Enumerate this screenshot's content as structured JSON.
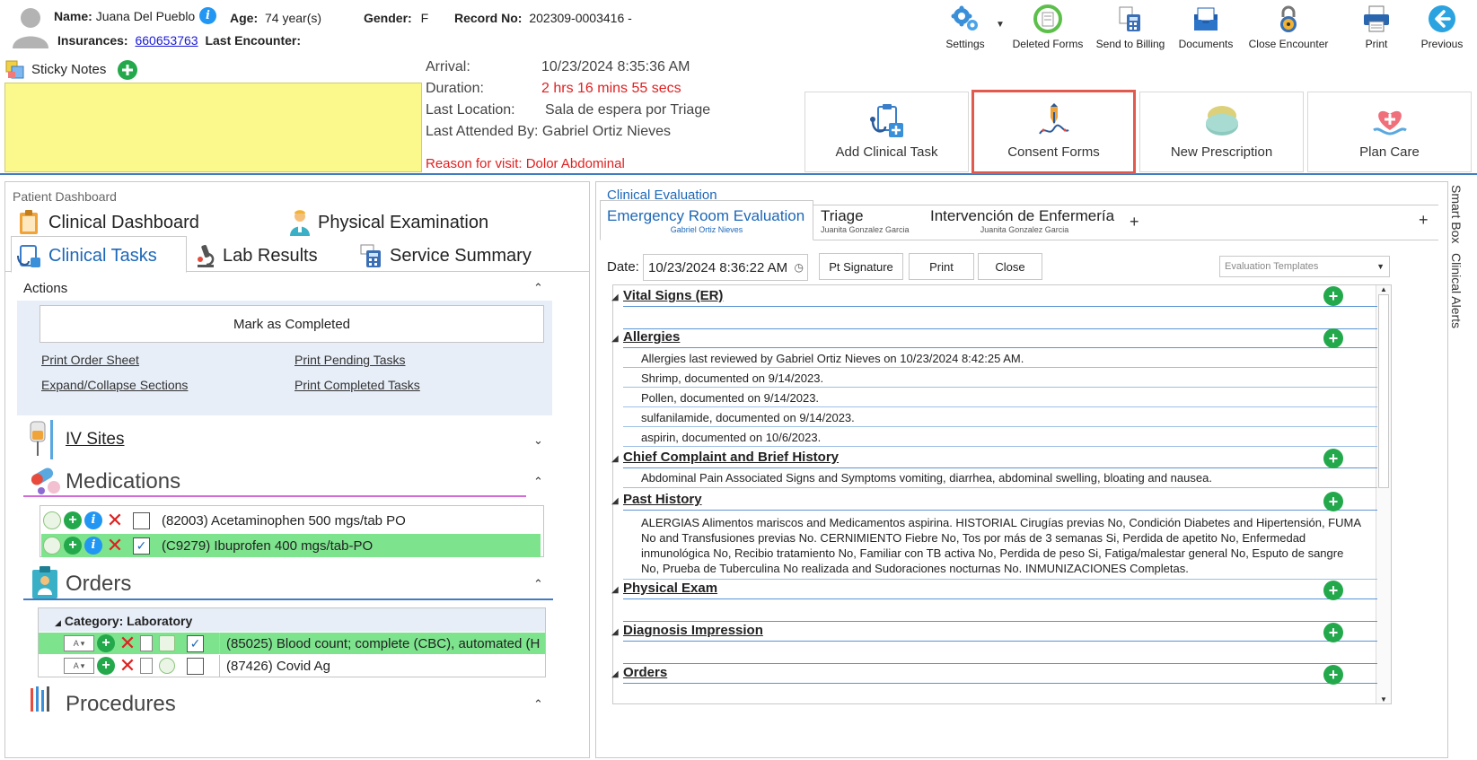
{
  "patient": {
    "name_label": "Name:",
    "name": "Juana Del Pueblo",
    "age_label": "Age:",
    "age": "74 year(s)",
    "gender_label": "Gender:",
    "gender": "F",
    "record_label": "Record No:",
    "record": "202309-0003416 -",
    "insurances_label": "Insurances:",
    "insurances": "660653763",
    "last_encounter_label": "Last Encounter:"
  },
  "toolbar": [
    {
      "label": "Settings",
      "icon": "gear-icon"
    },
    {
      "label": "Deleted Forms",
      "icon": "deleted-forms-icon"
    },
    {
      "label": "Send to Billing",
      "icon": "billing-icon"
    },
    {
      "label": "Documents",
      "icon": "documents-icon"
    },
    {
      "label": "Close Encounter",
      "icon": "lock-icon"
    },
    {
      "label": "Print",
      "icon": "printer-icon"
    },
    {
      "label": "Previous",
      "icon": "arrow-left-icon"
    }
  ],
  "sticky": {
    "label": "Sticky Notes"
  },
  "visit": {
    "arrival_label": "Arrival:",
    "arrival": "10/23/2024 8:35:36 AM",
    "duration_label": "Duration:",
    "duration": "2 hrs 16 mins 55 secs",
    "location_label": "Last Location:",
    "location": "Sala de espera por Triage",
    "attended_label": "Last Attended By:",
    "attended": "Gabriel Ortiz Nieves",
    "reason": "Reason for visit: Dolor Abdominal"
  },
  "actions_bar": [
    {
      "label": "Add Clinical Task"
    },
    {
      "label": "Consent Forms"
    },
    {
      "label": "New Prescription"
    },
    {
      "label": "Plan Care"
    }
  ],
  "left": {
    "title": "Patient Dashboard",
    "tabs": {
      "dashboard": "Clinical Dashboard",
      "physical": "Physical Examination",
      "tasks": "Clinical Tasks",
      "lab": "Lab Results",
      "service": "Service Summary"
    },
    "actions_title": "Actions",
    "mark_completed": "Mark as Completed",
    "print_order": "Print Order Sheet",
    "print_pending": "Print Pending Tasks",
    "expand_collapse": "Expand/Collapse Sections",
    "print_completed": "Print Completed Tasks",
    "iv_sites": "IV Sites",
    "medications_title": "Medications",
    "medications": [
      {
        "text": "(82003) Acetaminophen 500 mgs/tab PO",
        "checked": false
      },
      {
        "text": "(C9279) Ibuprofen 400 mgs/tab-PO",
        "checked": true
      }
    ],
    "orders_title": "Orders",
    "orders_category": "Category: Laboratory",
    "orders": [
      {
        "text": "(85025) Blood count; complete (CBC), automated (H",
        "checked": true
      },
      {
        "text": "(87426) Covid Ag",
        "checked": false
      }
    ],
    "procedures_title": "Procedures"
  },
  "right": {
    "title": "Clinical Evaluation",
    "tabs": [
      {
        "main": "Emergency Room Evaluation",
        "sub": "Gabriel Ortiz Nieves"
      },
      {
        "main": "Triage",
        "sub": "Juanita Gonzalez Garcia"
      },
      {
        "main": "Intervención de Enfermería",
        "sub": "Juanita Gonzalez Garcia"
      }
    ],
    "date_label": "Date:",
    "date_value": "10/23/2024 8:36:22 AM",
    "pt_signature": "Pt Signature",
    "print": "Print",
    "close": "Close",
    "templates_placeholder": "Evaluation Templates",
    "sections": {
      "vital_signs": "Vital Signs (ER)",
      "allergies": "Allergies",
      "allergy_items": [
        "Allergies last reviewed by Gabriel Ortiz Nieves on 10/23/2024 8:42:25 AM.",
        "Shrimp, documented on 9/14/2023.",
        "Pollen, documented on 9/14/2023.",
        "sulfanilamide, documented on 9/14/2023.",
        "aspirin, documented on 10/6/2023."
      ],
      "chief": "Chief Complaint and Brief History",
      "chief_text": "Abdominal Pain Associated Signs and Symptoms vomiting, diarrhea, abdominal swelling, bloating and nausea.",
      "past": "Past History",
      "past_lines": [
        "ALERGIAS Alimentos mariscos and Medicamentos aspirina. HISTORIAL Cirugías previas No, Condición Diabetes and Hipertensión, FUMA",
        "No and Transfusiones previas No. CERNIMIENTO Fiebre No, Tos por más de 3 semanas Si, Perdida de apetito No, Enfermedad",
        "inmunológica No, Recibio tratamiento No, Familiar con TB activa No, Perdida de peso Si, Fatiga/malestar general No, Esputo de sangre",
        "No, Prueba de Tuberculina No realizada and Sudoraciones nocturnas No. INMUNIZACIONES Completas."
      ],
      "physical": "Physical Exam",
      "diagnosis": "Diagnosis Impression",
      "orders": "Orders"
    }
  },
  "side": {
    "smart_box": "Smart Box",
    "clinical_alerts": "Clinical Alerts"
  },
  "colors": {
    "accent": "#1c67b8",
    "sticky": "#fbf88c",
    "highlight_row": "#7de38d",
    "alert_red": "#e02020",
    "add_green": "#23a94b"
  }
}
